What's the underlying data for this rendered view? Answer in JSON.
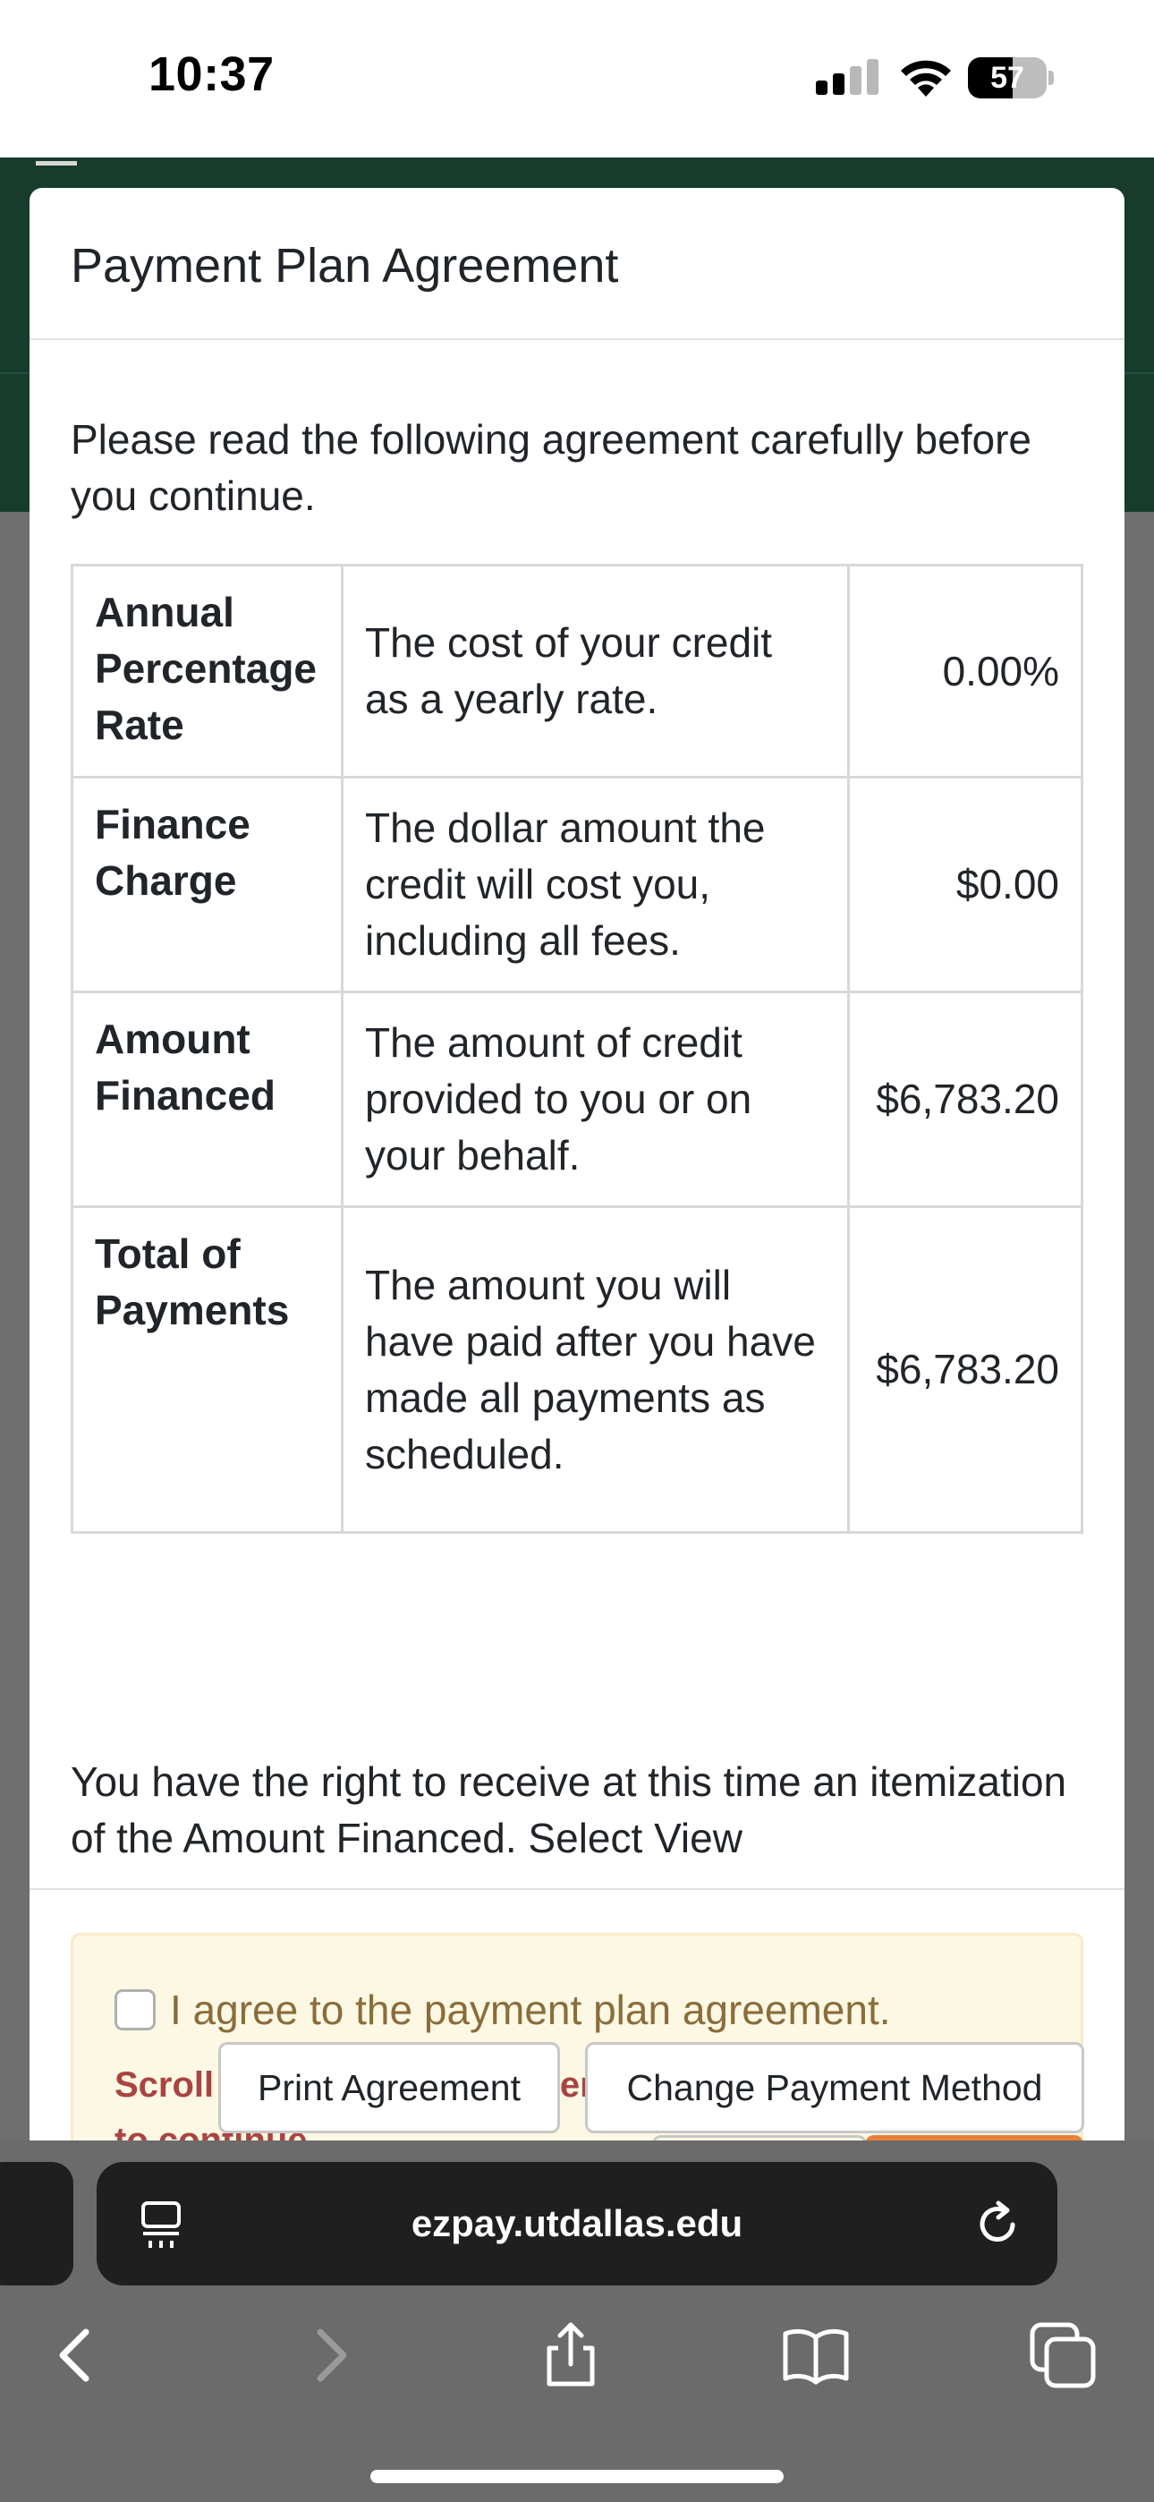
{
  "status_bar": {
    "time": "10:37",
    "battery_level": "57",
    "battery_fraction": 0.57
  },
  "modal": {
    "title": "Payment Plan Agreement",
    "intro": "Please read the following agreement carefully before you continue.",
    "terms": [
      {
        "term": "Annual Percentage Rate",
        "description": "The cost of your credit as a yearly rate.",
        "value": "0.00%"
      },
      {
        "term": "Finance Charge",
        "description": "The dollar amount the credit will cost you, including all fees.",
        "value": "$0.00"
      },
      {
        "term": "Amount Financed",
        "description": "The amount of credit provided to you or on your behalf.",
        "value": "$6,783.20"
      },
      {
        "term": "Total of Payments",
        "description": "The amount you will have paid after you have made all payments as scheduled.",
        "value": "$6,783.20"
      }
    ],
    "rights_text": "You have the right to receive at this time an itemization of the Amount Financed. Select View",
    "agree_label": "I agree to the payment plan agreement.",
    "agree_checked": false,
    "validation_message": "Scroll through the agreement and select the checkbox to continue.",
    "print_button": "Print Agreement",
    "change_button": "Change Payment Method"
  },
  "browser": {
    "url": "ezpay.utdallas.edu"
  },
  "icons": {
    "tabs_overview": "tabs-icon",
    "reload": "reload-icon",
    "back": "chevron-left-icon",
    "forward": "chevron-right-icon",
    "share": "share-icon",
    "bookmarks": "book-icon",
    "tabs": "tabs-stack-icon"
  },
  "colors": {
    "header_green": "#173c2b",
    "warning_bg": "#fcf8e3",
    "warning_text": "#8a6d3b",
    "error_text": "#a94442",
    "accent_orange": "#e8823a"
  }
}
